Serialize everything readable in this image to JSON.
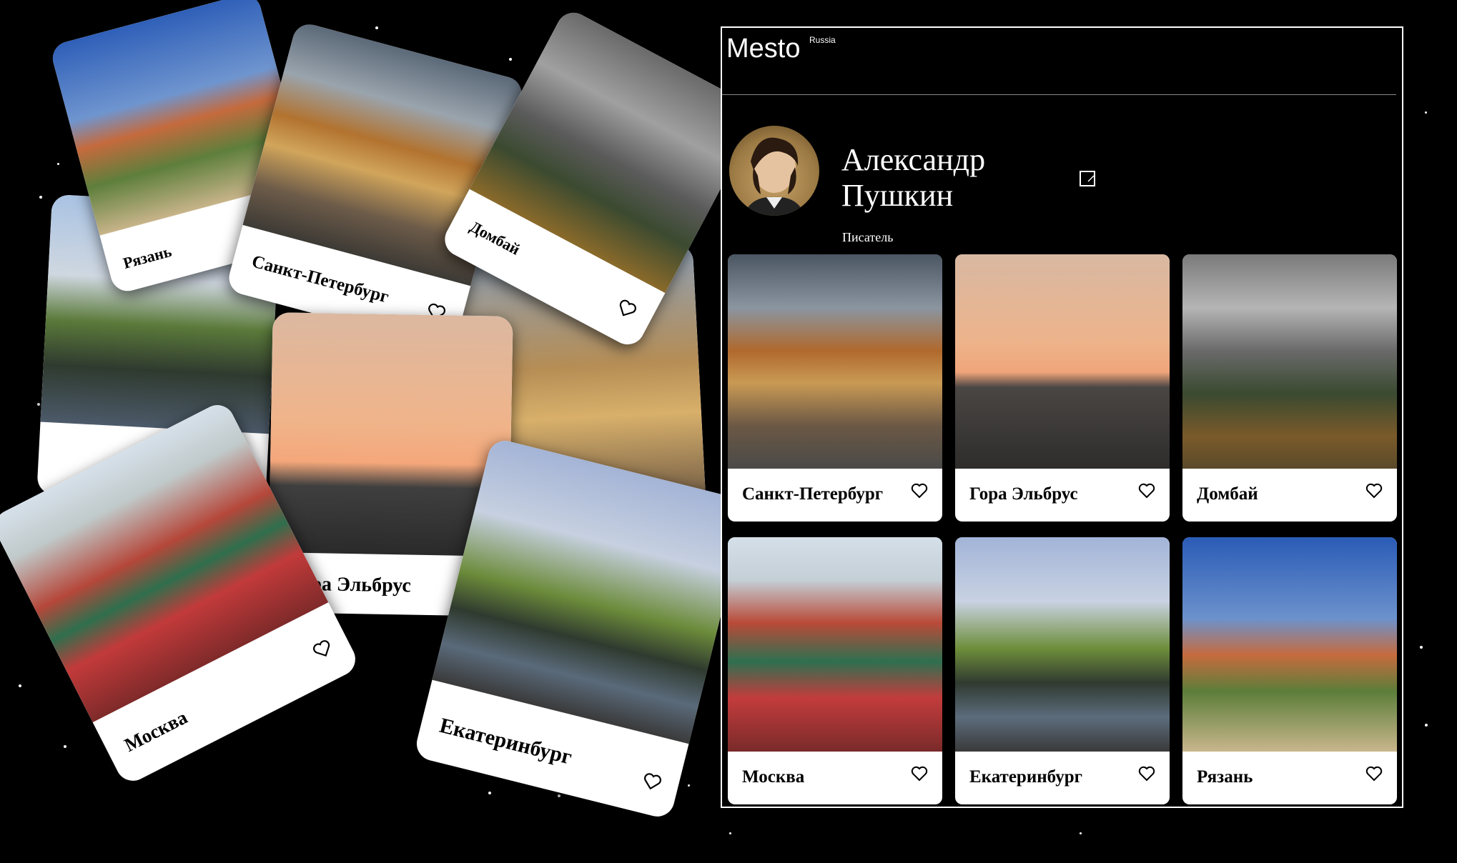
{
  "app": {
    "logo": "Mesto",
    "logo_sup": "Russia",
    "profile": {
      "name": "Александр Пушкин",
      "about": "Писатель"
    }
  },
  "cards": [
    {
      "title": "Санкт-Петербург",
      "icon": "heart-icon"
    },
    {
      "title": "Гора Эльбрус",
      "icon": "heart-icon"
    },
    {
      "title": "Домбай",
      "icon": "heart-icon"
    },
    {
      "title": "Москва",
      "icon": "heart-icon"
    },
    {
      "title": "Екатеринбург",
      "icon": "heart-icon"
    },
    {
      "title": "Рязань",
      "icon": "heart-icon"
    }
  ],
  "scatter": [
    {
      "title": "Рязань"
    },
    {
      "title": "Санкт-Петербург"
    },
    {
      "title": "Домбай"
    },
    {
      "title": "Гора Эльбрус"
    },
    {
      "title": "Москва"
    },
    {
      "title": "Екатеринбург"
    }
  ],
  "colors": {
    "background": "#000000",
    "panel_border": "#ffffff",
    "card_bg": "#ffffff"
  }
}
